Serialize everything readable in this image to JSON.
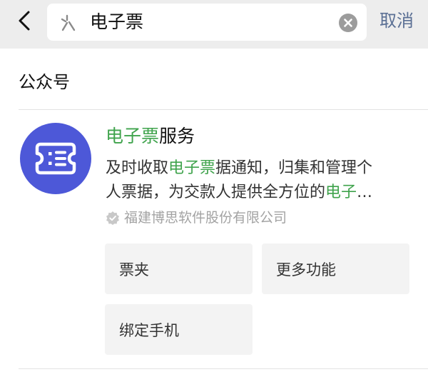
{
  "search": {
    "query": "电子票",
    "cancel_label": "取消"
  },
  "results": {
    "section_title": "公众号",
    "account": {
      "name_highlight": "电子票",
      "name_rest": "服务",
      "description_line1_a": "及时收取",
      "description_line1_highlight": "电子票",
      "description_line1_b": "据通知，归集和管理个",
      "description_line2_a": "人票据，为交款人提供全方位的",
      "description_line2_highlight": "电子",
      "description_line2_ellipsis": "…",
      "company": "福建博思软件股份有限公司"
    },
    "actions": [
      "票夹",
      "更多功能",
      "绑定手机"
    ]
  },
  "colors": {
    "highlight": "#3fa34c",
    "avatar": "#4d58d8",
    "cancel": "#5a6f94"
  }
}
